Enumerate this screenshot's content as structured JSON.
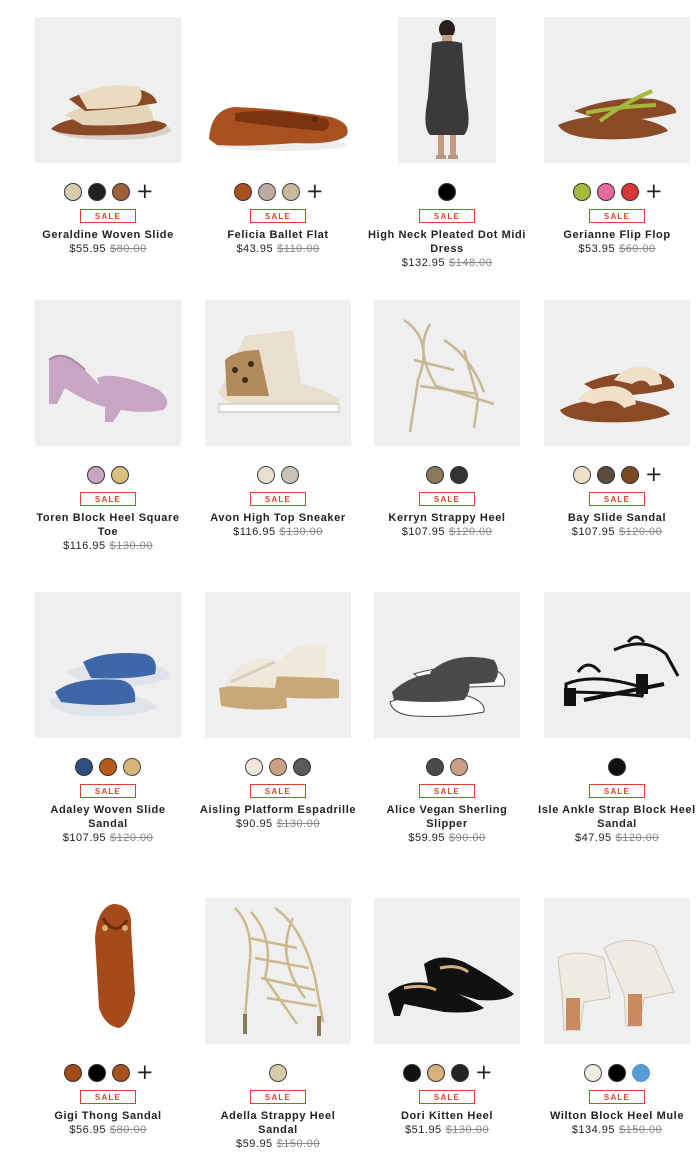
{
  "sale_label": "SALE",
  "products": [
    {
      "name": "Geraldine Woven Slide",
      "price": "$55.95",
      "old_price": "$80.00",
      "image": "woven-slide-photo",
      "swatches": [
        "#d8cbb0",
        "#222222",
        "#a0603a"
      ],
      "more": "+"
    },
    {
      "name": "Felicia Ballet Flat",
      "price": "$43.95",
      "old_price": "$110.00",
      "image": "ballet-flat-photo",
      "swatches": [
        "#a8501f",
        "#b9ada0",
        "#c9b79c"
      ],
      "more": "+"
    },
    {
      "name": "High Neck Pleated Dot Midi Dress",
      "price": "$132.95",
      "old_price": "$148.00",
      "image": "dress-photo",
      "swatches": [
        "#000000"
      ],
      "more": ""
    },
    {
      "name": "Gerianne Flip Flop",
      "price": "$53.95",
      "old_price": "$60.00",
      "image": "flip-flop-photo",
      "swatches": [
        "#a3b93c",
        "#e46aa0",
        "#d93636"
      ],
      "more": "+"
    },
    {
      "name": "Toren Block Heel Square Toe",
      "price": "$116.95",
      "old_price": "$130.00",
      "image": "block-heel-photo",
      "swatches": [
        "#c8a6c3",
        "#d8bf80"
      ],
      "more": ""
    },
    {
      "name": "Avon High Top Sneaker",
      "price": "$116.95",
      "old_price": "$130.00",
      "image": "sneaker-photo",
      "swatches": [
        "#e8dfcf",
        "#c9c2b7"
      ],
      "more": ""
    },
    {
      "name": "Kerryn Strappy Heel",
      "price": "$107.95",
      "old_price": "$120.00",
      "image": "strappy-heel-photo",
      "swatches": [
        "#8a7a5a",
        "#333333"
      ],
      "more": ""
    },
    {
      "name": "Bay Slide Sandal",
      "price": "$107.95",
      "old_price": "$120.00",
      "image": "slide-sandal-photo",
      "swatches": [
        "#f0e0c8",
        "#5c4a3a",
        "#7a4a20"
      ],
      "more": "+"
    },
    {
      "name": "Adaley Woven Slide Sandal",
      "price": "$107.95",
      "old_price": "$120.00",
      "image": "blue-slide-photo",
      "swatches": [
        "#2f4f7f",
        "#b65a1c",
        "#d8b67a"
      ],
      "more": ""
    },
    {
      "name": "Aisling Platform Espadrille",
      "price": "$90.95",
      "old_price": "$130.00",
      "image": "espadrille-photo",
      "swatches": [
        "#efe9dc",
        "#caa084",
        "#5a5a5a"
      ],
      "more": ""
    },
    {
      "name": "Alice Vegan Sherling Slipper",
      "price": "$59.95",
      "old_price": "$90.00",
      "image": "slipper-photo",
      "swatches": [
        "#4a4a4a",
        "#c9a084"
      ],
      "more": ""
    },
    {
      "name": "Isle Ankle Strap Block Heel Sandal",
      "price": "$47.95",
      "old_price": "$120.00",
      "image": "ankle-strap-photo",
      "swatches": [
        "#111111"
      ],
      "more": ""
    },
    {
      "name": "Gigi Thong Sandal",
      "price": "$56.95",
      "old_price": "$80.00",
      "image": "thong-sandal-photo",
      "swatches": [
        "#a54a1a",
        "#000000",
        "#a8501f"
      ],
      "more": "+"
    },
    {
      "name": "Adella Strappy Heel Sandal",
      "price": "$59.95",
      "old_price": "$150.00",
      "image": "lace-up-heel-photo",
      "swatches": [
        "#d8c9a8"
      ],
      "more": ""
    },
    {
      "name": "Dori Kitten Heel",
      "price": "$51.95",
      "old_price": "$130.00",
      "image": "kitten-heel-photo",
      "swatches": [
        "#111111",
        "#d8b07a",
        "#222222"
      ],
      "more": "+"
    },
    {
      "name": "Wilton Block Heel Mule",
      "price": "$134.95",
      "old_price": "$150.00",
      "image": "mule-photo",
      "swatches": [
        "#f0ebe0",
        "#000000",
        "#5b9bd5"
      ],
      "more": ""
    }
  ]
}
